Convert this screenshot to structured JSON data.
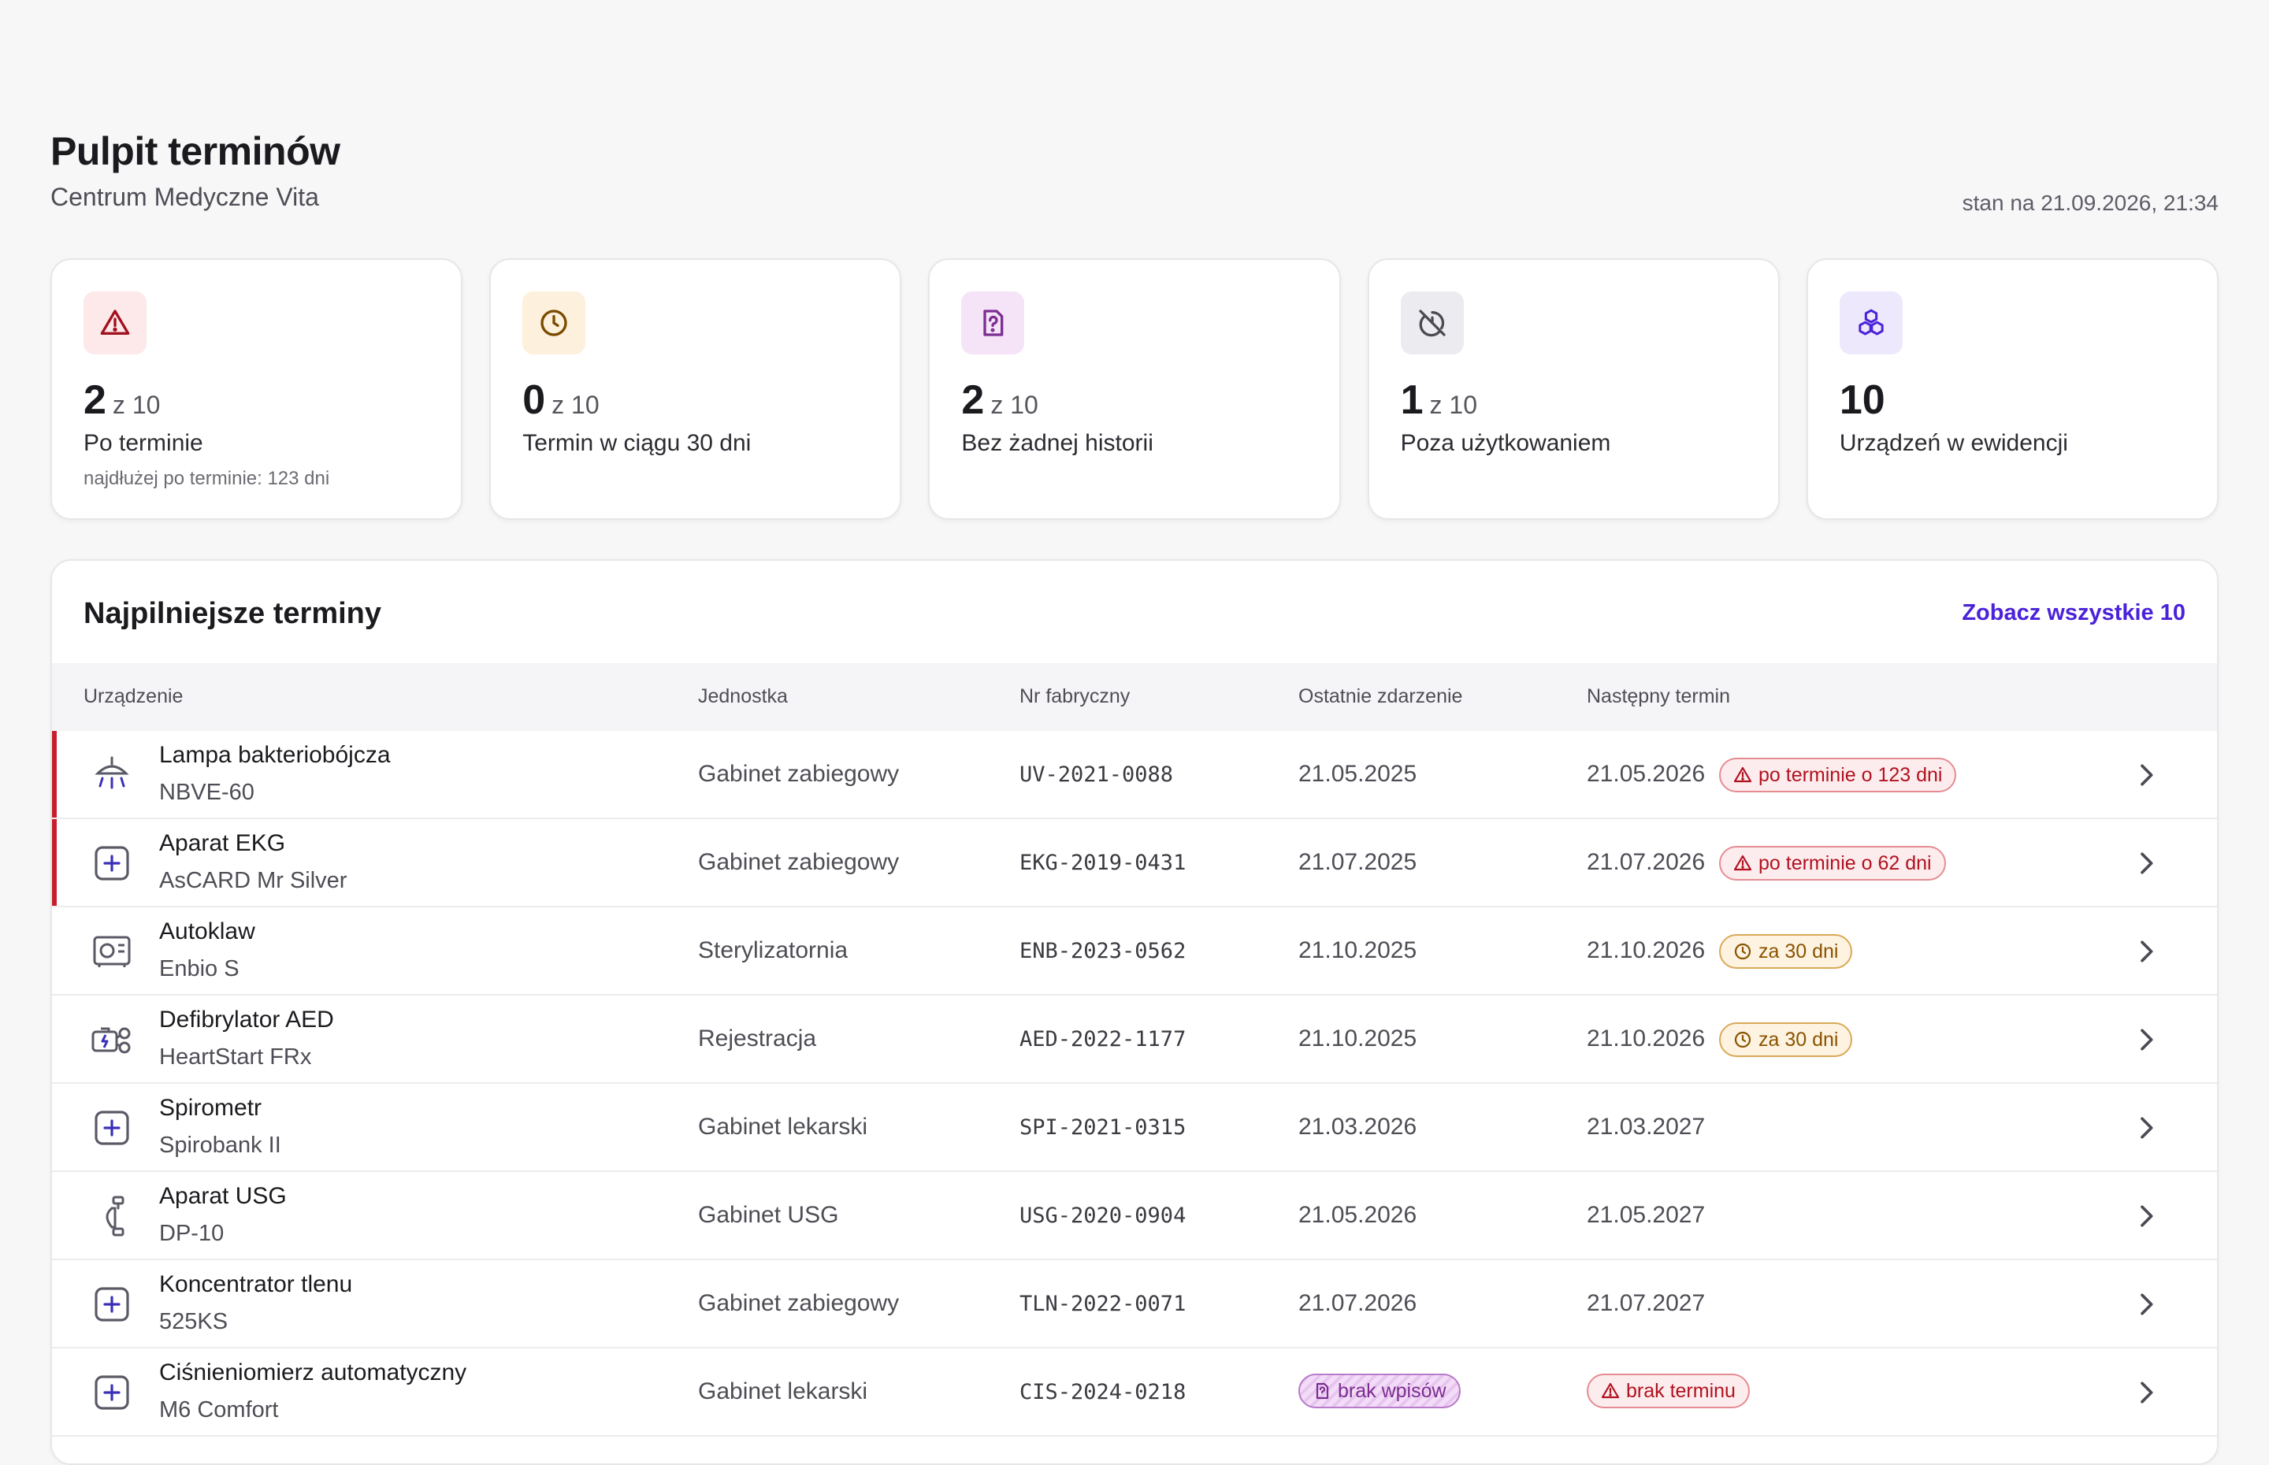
{
  "header": {
    "title": "Pulpit terminów",
    "subtitle": "Centrum Medyczne Vita",
    "stamp": "stan na 21.09.2026, 21:34"
  },
  "cards": [
    {
      "icon": "warning-triangle-icon",
      "value": "2",
      "of": "z 10",
      "label": "Po terminie",
      "note": "najdłużej po terminie: 123 dni",
      "bg": "#fde8ea",
      "fg": "#a0101d"
    },
    {
      "icon": "clock-icon",
      "value": "0",
      "of": "z 10",
      "label": "Termin w ciągu 30 dni",
      "note": "",
      "bg": "#fdf0dc",
      "fg": "#7a4a00"
    },
    {
      "icon": "document-question-icon",
      "value": "2",
      "of": "z 10",
      "label": "Bez żadnej historii",
      "note": "",
      "bg": "#f5e3f8",
      "fg": "#7c2e91"
    },
    {
      "icon": "timer-off-icon",
      "value": "1",
      "of": "z 10",
      "label": "Poza użytkowaniem",
      "note": "",
      "bg": "#ececf0",
      "fg": "#4a4a52"
    },
    {
      "icon": "cubes-icon",
      "value": "10",
      "of": "",
      "label": "Urządzeń w ewidencji",
      "note": "",
      "bg": "#ede8fc",
      "fg": "#4b22d9"
    }
  ],
  "panel": {
    "title": "Najpilniejsze terminy",
    "see_all": "Zobacz wszystkie 10",
    "columns": {
      "device": "Urządzenie",
      "unit": "Jednostka",
      "serial": "Nr fabryczny",
      "last": "Ostatnie zdarzenie",
      "next": "Następny termin"
    }
  },
  "rows": [
    {
      "name": "Lampa bakteriobójcza",
      "model": "NBVE-60",
      "unit": "Gabinet zabiegowy",
      "serial": "UV-2021-0088",
      "last": "21.05.2025",
      "next": "21.05.2026",
      "badge": "po terminie o 123 dni",
      "badge_type": "red",
      "icon": "uv-lamp-icon",
      "overdue": true
    },
    {
      "name": "Aparat EKG",
      "model": "AsCARD Mr Silver",
      "unit": "Gabinet zabiegowy",
      "serial": "EKG-2019-0431",
      "last": "21.07.2025",
      "next": "21.07.2026",
      "badge": "po terminie o 62 dni",
      "badge_type": "red",
      "icon": "plus-square-icon",
      "overdue": true
    },
    {
      "name": "Autoklaw",
      "model": "Enbio S",
      "unit": "Sterylizatornia",
      "serial": "ENB-2023-0562",
      "last": "21.10.2025",
      "next": "21.10.2026",
      "badge": "za 30 dni",
      "badge_type": "amber",
      "icon": "autoclave-icon",
      "overdue": false
    },
    {
      "name": "Defibrylator AED",
      "model": "HeartStart FRx",
      "unit": "Rejestracja",
      "serial": "AED-2022-1177",
      "last": "21.10.2025",
      "next": "21.10.2026",
      "badge": "za 30 dni",
      "badge_type": "amber",
      "icon": "defibrillator-icon",
      "overdue": false
    },
    {
      "name": "Spirometr",
      "model": "Spirobank II",
      "unit": "Gabinet lekarski",
      "serial": "SPI-2021-0315",
      "last": "21.03.2026",
      "next": "21.03.2027",
      "badge": "",
      "badge_type": "",
      "icon": "plus-square-icon",
      "overdue": false
    },
    {
      "name": "Aparat USG",
      "model": "DP-10",
      "unit": "Gabinet USG",
      "serial": "USG-2020-0904",
      "last": "21.05.2026",
      "next": "21.05.2027",
      "badge": "",
      "badge_type": "",
      "icon": "ultrasound-probe-icon",
      "overdue": false
    },
    {
      "name": "Koncentrator tlenu",
      "model": "525KS",
      "unit": "Gabinet zabiegowy",
      "serial": "TLN-2022-0071",
      "last": "21.07.2026",
      "next": "21.07.2027",
      "badge": "",
      "badge_type": "",
      "icon": "plus-square-icon",
      "overdue": false
    },
    {
      "name": "Ciśnieniomierz automatyczny",
      "model": "M6 Comfort",
      "unit": "Gabinet lekarski",
      "serial": "CIS-2024-0218",
      "last": "",
      "next": "",
      "last_badge": "brak wpisów",
      "badge": "brak terminu",
      "badge_type": "red",
      "icon": "plus-square-icon",
      "overdue": false
    }
  ]
}
